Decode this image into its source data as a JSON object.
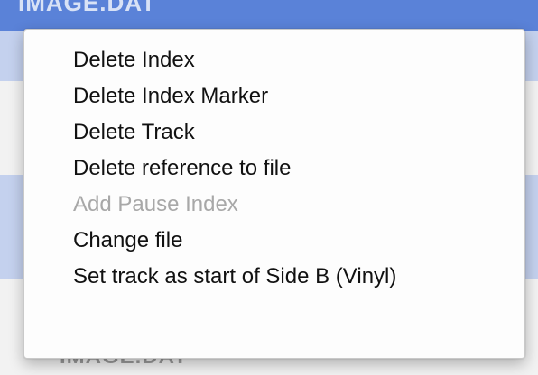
{
  "background": {
    "top_row_label": "IMAGE.DAT",
    "bottom_row_label": "IMAGE.DAT"
  },
  "menu": {
    "items": [
      {
        "label": "Delete Index",
        "enabled": true
      },
      {
        "label": "Delete Index Marker",
        "enabled": true
      },
      {
        "label": "Delete Track",
        "enabled": true
      },
      {
        "label": "Delete reference to file",
        "enabled": true
      },
      {
        "label": "Add Pause Index",
        "enabled": false
      },
      {
        "label": "Change file",
        "enabled": true
      },
      {
        "label": "Set track as start of Side B (Vinyl)",
        "enabled": true
      }
    ]
  },
  "colors": {
    "selection": "#5a82d8",
    "alternate_row": "#c4d1ee",
    "disabled_text": "#a8a8a8"
  }
}
